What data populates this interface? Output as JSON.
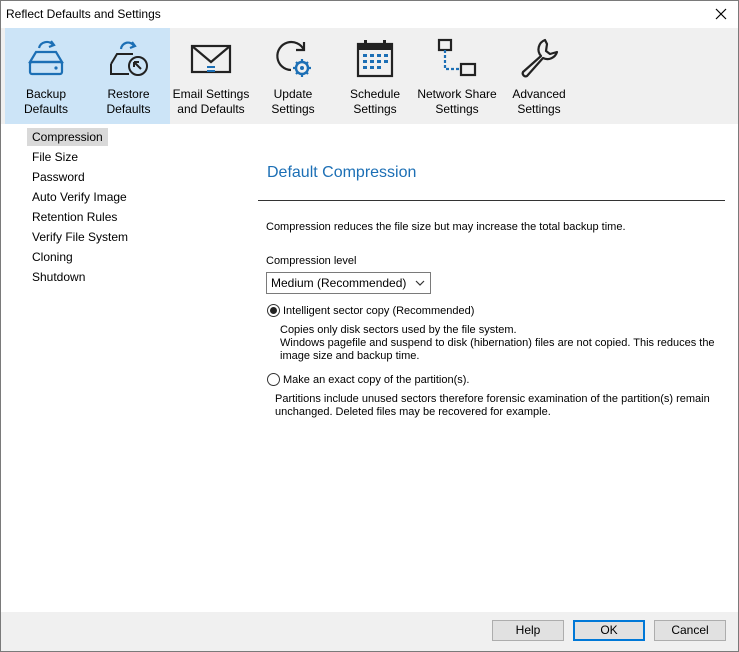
{
  "window": {
    "title": "Reflect Defaults and Settings"
  },
  "toolbar": {
    "items": [
      {
        "line1": "Backup",
        "line2": "Defaults",
        "icon": "backup-disk-icon"
      },
      {
        "line1": "Restore",
        "line2": "Defaults",
        "icon": "restore-disk-icon"
      },
      {
        "line1": "Email Settings",
        "line2": "and Defaults",
        "icon": "envelope-icon"
      },
      {
        "line1": "Update",
        "line2": "Settings",
        "icon": "update-gear-icon"
      },
      {
        "line1": "Schedule",
        "line2": "Settings",
        "icon": "calendar-icon"
      },
      {
        "line1": "Network Share",
        "line2": "Settings",
        "icon": "network-share-icon"
      },
      {
        "line1": "Advanced",
        "line2": "Settings",
        "icon": "wrench-icon"
      }
    ],
    "active_color": "#cce4f7"
  },
  "sidebar": {
    "items": [
      "Compression",
      "File Size",
      "Password",
      "Auto Verify Image",
      "Retention Rules",
      "Verify File System",
      "Cloning",
      "Shutdown"
    ]
  },
  "main": {
    "heading": "Default Compression",
    "description": "Compression reduces the file size but may increase the total backup time.",
    "level_label": "Compression level",
    "level_value": "Medium (Recommended)",
    "option1": {
      "label": "Intelligent sector copy (Recommended)",
      "note1": "Copies only disk sectors used by the file system.",
      "note2": "Windows pagefile and suspend to disk (hibernation) files are not copied. This reduces the",
      "note3": "image size and backup time."
    },
    "option2": {
      "label": "Make an exact copy of the partition(s).",
      "note1": "Partitions include unused sectors therefore forensic examination of the partition(s) remain",
      "note2": "unchanged. Deleted files may be recovered for example."
    },
    "heading_color": "#1c6fb5"
  },
  "footer": {
    "help": "Help",
    "ok": "OK",
    "cancel": "Cancel"
  }
}
